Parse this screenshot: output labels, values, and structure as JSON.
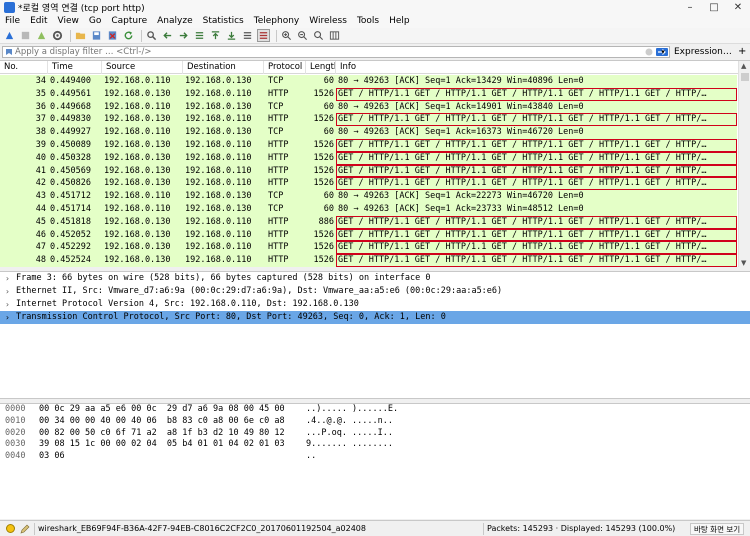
{
  "window": {
    "title": "*로컬 영역 연결 (tcp port http)",
    "controls": [
      "–",
      "□",
      "✕"
    ]
  },
  "menu": [
    "File",
    "Edit",
    "View",
    "Go",
    "Capture",
    "Analyze",
    "Statistics",
    "Telephony",
    "Wireless",
    "Tools",
    "Help"
  ],
  "filter": {
    "placeholder": "Apply a display filter … <Ctrl-/>",
    "value": "",
    "expression_label": "Expression…",
    "plus_label": "+"
  },
  "packet_list": {
    "columns": [
      "No.",
      "Time",
      "Source",
      "Destination",
      "Protocol",
      "Length",
      "Info"
    ],
    "rows": [
      {
        "no": "34",
        "time": "0.449400",
        "src": "192.168.0.110",
        "dst": "192.168.0.130",
        "proto": "TCP",
        "len": "60",
        "info": "80 → 49263 [ACK] Seq=1 Ack=13429 Win=40896 Len=0",
        "boxed": false
      },
      {
        "no": "35",
        "time": "0.449561",
        "src": "192.168.0.130",
        "dst": "192.168.0.110",
        "proto": "HTTP",
        "len": "1526",
        "info": "GET / HTTP/1.1 GET / HTTP/1.1 GET / HTTP/1.1 GET / HTTP/1.1 GET / HTTP/…",
        "boxed": true
      },
      {
        "no": "36",
        "time": "0.449668",
        "src": "192.168.0.110",
        "dst": "192.168.0.130",
        "proto": "TCP",
        "len": "60",
        "info": "80 → 49263 [ACK] Seq=1 Ack=14901 Win=43840 Len=0",
        "boxed": false
      },
      {
        "no": "37",
        "time": "0.449830",
        "src": "192.168.0.130",
        "dst": "192.168.0.110",
        "proto": "HTTP",
        "len": "1526",
        "info": "GET / HTTP/1.1 GET / HTTP/1.1 GET / HTTP/1.1 GET / HTTP/1.1 GET / HTTP/…",
        "boxed": true
      },
      {
        "no": "38",
        "time": "0.449927",
        "src": "192.168.0.110",
        "dst": "192.168.0.130",
        "proto": "TCP",
        "len": "60",
        "info": "80 → 49263 [ACK] Seq=1 Ack=16373 Win=46720 Len=0",
        "boxed": false
      },
      {
        "no": "39",
        "time": "0.450089",
        "src": "192.168.0.130",
        "dst": "192.168.0.110",
        "proto": "HTTP",
        "len": "1526",
        "info": "GET / HTTP/1.1 GET / HTTP/1.1 GET / HTTP/1.1 GET / HTTP/1.1 GET / HTTP/…",
        "boxed": true
      },
      {
        "no": "40",
        "time": "0.450328",
        "src": "192.168.0.130",
        "dst": "192.168.0.110",
        "proto": "HTTP",
        "len": "1526",
        "info": "GET / HTTP/1.1 GET / HTTP/1.1 GET / HTTP/1.1 GET / HTTP/1.1 GET / HTTP/…",
        "boxed": true
      },
      {
        "no": "41",
        "time": "0.450569",
        "src": "192.168.0.130",
        "dst": "192.168.0.110",
        "proto": "HTTP",
        "len": "1526",
        "info": "GET / HTTP/1.1 GET / HTTP/1.1 GET / HTTP/1.1 GET / HTTP/1.1 GET / HTTP/…",
        "boxed": true
      },
      {
        "no": "42",
        "time": "0.450826",
        "src": "192.168.0.130",
        "dst": "192.168.0.110",
        "proto": "HTTP",
        "len": "1526",
        "info": "GET / HTTP/1.1 GET / HTTP/1.1 GET / HTTP/1.1 GET / HTTP/1.1 GET / HTTP/…",
        "boxed": true
      },
      {
        "no": "43",
        "time": "0.451712",
        "src": "192.168.0.110",
        "dst": "192.168.0.130",
        "proto": "TCP",
        "len": "60",
        "info": "80 → 49263 [ACK] Seq=1 Ack=22273 Win=46720 Len=0",
        "boxed": false
      },
      {
        "no": "44",
        "time": "0.451714",
        "src": "192.168.0.110",
        "dst": "192.168.0.130",
        "proto": "TCP",
        "len": "60",
        "info": "80 → 49263 [ACK] Seq=1 Ack=23733 Win=48512 Len=0",
        "boxed": false
      },
      {
        "no": "45",
        "time": "0.451818",
        "src": "192.168.0.130",
        "dst": "192.168.0.110",
        "proto": "HTTP",
        "len": "886",
        "info": "GET / HTTP/1.1 GET / HTTP/1.1 GET / HTTP/1.1 GET / HTTP/1.1 GET / HTTP/…",
        "boxed": true
      },
      {
        "no": "46",
        "time": "0.452052",
        "src": "192.168.0.130",
        "dst": "192.168.0.110",
        "proto": "HTTP",
        "len": "1526",
        "info": "GET / HTTP/1.1 GET / HTTP/1.1 GET / HTTP/1.1 GET / HTTP/1.1 GET / HTTP/…",
        "boxed": true
      },
      {
        "no": "47",
        "time": "0.452292",
        "src": "192.168.0.130",
        "dst": "192.168.0.110",
        "proto": "HTTP",
        "len": "1526",
        "info": "GET / HTTP/1.1 GET / HTTP/1.1 GET / HTTP/1.1 GET / HTTP/1.1 GET / HTTP/…",
        "boxed": true
      },
      {
        "no": "48",
        "time": "0.452524",
        "src": "192.168.0.130",
        "dst": "192.168.0.110",
        "proto": "HTTP",
        "len": "1526",
        "info": "GET / HTTP/1.1 GET / HTTP/1.1 GET / HTTP/1.1 GET / HTTP/1.1 GET / HTTP/…",
        "boxed": true
      }
    ]
  },
  "details": [
    {
      "text": "Frame 3: 66 bytes on wire (528 bits), 66 bytes captured (528 bits) on interface 0",
      "selected": false
    },
    {
      "text": "Ethernet II, Src: Vmware_d7:a6:9a (00:0c:29:d7:a6:9a), Dst: Vmware_aa:a5:e6 (00:0c:29:aa:a5:e6)",
      "selected": false
    },
    {
      "text": "Internet Protocol Version 4, Src: 192.168.0.110, Dst: 192.168.0.130",
      "selected": false
    },
    {
      "text": "Transmission Control Protocol, Src Port: 80, Dst Port: 49263, Seq: 0, Ack: 1, Len: 0",
      "selected": true
    }
  ],
  "bytes": [
    {
      "offset": "0000",
      "hex": "00 0c 29 aa a5 e6 00 0c  29 d7 a6 9a 08 00 45 00",
      "ascii": "..)..... )......E."
    },
    {
      "offset": "0010",
      "hex": "00 34 00 00 40 00 40 06  b8 83 c0 a8 00 6e c0 a8",
      "ascii": ".4..@.@. .....n.."
    },
    {
      "offset": "0020",
      "hex": "00 82 00 50 c0 6f 71 a2  a8 1f b3 d2 10 49 80 12",
      "ascii": "...P.oq. .....I.."
    },
    {
      "offset": "0030",
      "hex": "39 08 15 1c 00 00 02 04  05 b4 01 01 04 02 01 03",
      "ascii": "9....... ........"
    },
    {
      "offset": "0040",
      "hex": "03 06",
      "ascii": ".."
    }
  ],
  "status": {
    "file": "wireshark_EB69F94F-B36A-42F7-94EB-C8016C2CF2C0_20170601192504_a02408",
    "packets": "Packets: 145293 · Displayed: 145293 (100.0%)",
    "profile": "바탕 화면 보기"
  },
  "colors": {
    "row_bg": "#e4ffc7",
    "box": "#d0021b",
    "selected": "#6aa6e6"
  }
}
